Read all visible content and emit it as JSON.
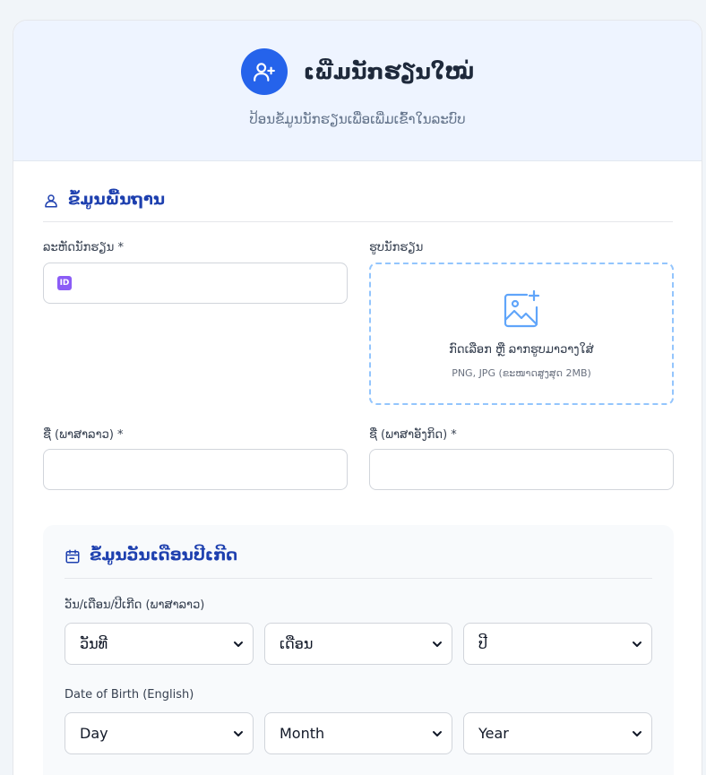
{
  "header": {
    "title": "ເພີ່ມນັກຮຽນໃໝ່",
    "subtitle": "ປ້ອນຂໍ້ມູນນັກຮຽນເພື່ອເພີ່ມເຂົ້າໃນລະບົບ",
    "icon": "user-plus-icon"
  },
  "basic_info": {
    "title": "ຂໍ້ມູນພື້ນຖານ",
    "icon": "user-icon",
    "student_id_label": "ລະຫັດນັກຮຽນ *",
    "student_id_value": "",
    "photo_label": "ຮູບນັກຮຽນ",
    "photo_drop_text": "ກົດເລືອກ ຫຼື ລາກຮູບມາວາງໃສ່",
    "photo_drop_hint": "PNG, JPG (ຂະໜາດສູງສຸດ 2MB)",
    "name_lao_label": "ຊື່ (ພາສາລາວ) *",
    "name_lao_value": "",
    "name_en_label": "ຊື່ (ພາສາອັງກິດ) *",
    "name_en_value": ""
  },
  "dob": {
    "title": "ຂໍ້ມູນວັນເດືອນປີເກີດ",
    "icon": "calendar-icon",
    "lao_label": "ວັນ/ເດືອນ/ປີເກີດ (ພາສາລາວ)",
    "lao_day": "ວັນທີ",
    "lao_month": "ເດືອນ",
    "lao_year": "ປີ",
    "en_label": "Date of Birth (English)",
    "en_day": "Day",
    "en_month": "Month",
    "en_year": "Year"
  },
  "colors": {
    "primary": "#2563eb",
    "section_title": "#1e40af",
    "header_bg": "#eef4ff",
    "dropzone_border": "#93c5fd",
    "id_badge": "#8b5cf6"
  }
}
